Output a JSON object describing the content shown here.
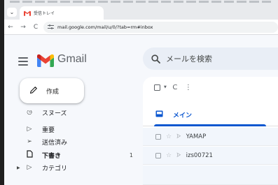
{
  "browser": {
    "tab_title": "受信トレイ",
    "tab_list_symbol": "⌄",
    "url": "mail.google.com/mail/u/0/?tab=rm#inbox",
    "back_symbol": "←",
    "forward_symbol": "→",
    "reload_symbol": "C"
  },
  "gmail": {
    "brand": "Gmail",
    "search_placeholder": "メールを検索",
    "compose_label": "作成",
    "sidebar": {
      "items": [
        {
          "label": "スヌーズ",
          "icon": "clock-icon"
        },
        {
          "label": "重要",
          "icon": "important-icon"
        },
        {
          "label": "送信済み",
          "icon": "send-icon"
        },
        {
          "label": "下書き",
          "icon": "draft-icon",
          "count": "1"
        },
        {
          "label": "カテゴリ",
          "icon": "label-icon"
        }
      ]
    },
    "toolbar": {
      "refresh_symbol": "C",
      "more_symbol": "⋮"
    },
    "tabs": {
      "primary_label": "メイン"
    },
    "emails": [
      {
        "sender": "YAMAP"
      },
      {
        "sender": "izs00721"
      }
    ]
  },
  "colors": {
    "accent": "#0b57d0",
    "gmail_red": "#ea4335",
    "gmail_blue": "#4285f4",
    "gmail_green": "#34a853",
    "gmail_yellow": "#fbbc04"
  }
}
